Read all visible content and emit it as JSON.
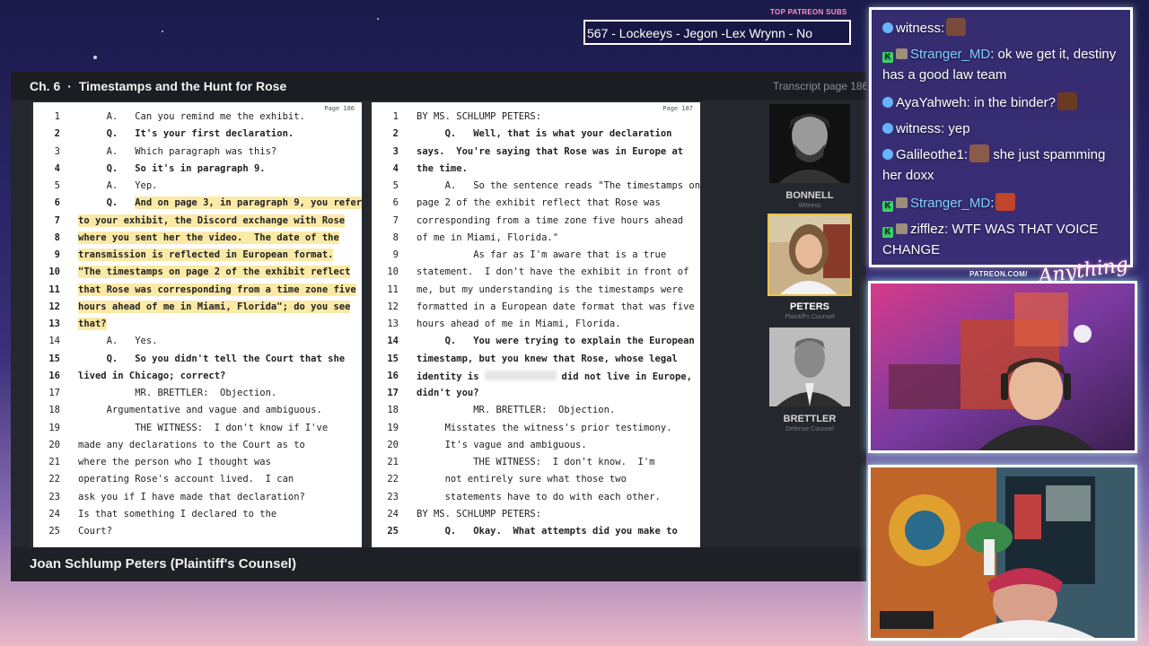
{
  "patreon": {
    "label": "TOP PATREON SUBS",
    "ticker": "567 - Lockeeys - Jegon -Lex Wrynn -  No"
  },
  "panel": {
    "chapter": "Ch. 6",
    "separator": "·",
    "chapter_title": "Timestamps and the Hunt for Rose",
    "transcript_page_label": "Transcript page 186",
    "speaker_caption": "Joan Schlump Peters (Plaintiff's Counsel)"
  },
  "left_page": {
    "page_label": "Page 186",
    "lines": [
      {
        "n": "1",
        "text": "     A.   Can you remind me the exhibit.",
        "bold": false,
        "hl": false
      },
      {
        "n": "2",
        "text": "     Q.   It's your first declaration.",
        "bold": true,
        "hl": false
      },
      {
        "n": "3",
        "text": "     A.   Which paragraph was this?",
        "bold": false,
        "hl": false
      },
      {
        "n": "4",
        "text": "     Q.   So it's in paragraph 9.",
        "bold": true,
        "hl": false
      },
      {
        "n": "5",
        "text": "     A.   Yep.",
        "bold": false,
        "hl": false
      },
      {
        "n": "6",
        "prefix": "     Q.   ",
        "text": "And on page 3, in paragraph 9, you refer",
        "bold": true,
        "hl": true
      },
      {
        "n": "7",
        "text": "to your exhibit, the Discord exchange with Rose",
        "bold": true,
        "hl": true
      },
      {
        "n": "8",
        "text": "where you sent her the video.  The date of the",
        "bold": true,
        "hl": true
      },
      {
        "n": "9",
        "text": "transmission is reflected in European format.",
        "bold": true,
        "hl": true
      },
      {
        "n": "10",
        "text": "\"The timestamps on page 2 of the exhibit reflect",
        "bold": true,
        "hl": true
      },
      {
        "n": "11",
        "text": "that Rose was corresponding from a time zone five",
        "bold": true,
        "hl": true
      },
      {
        "n": "12",
        "text": "hours ahead of me in Miami, Florida\"; do you see",
        "bold": true,
        "hl": true
      },
      {
        "n": "13",
        "text": "that?",
        "bold": true,
        "hl": true
      },
      {
        "n": "14",
        "text": "     A.   Yes.",
        "bold": false,
        "hl": false
      },
      {
        "n": "15",
        "text": "     Q.   So you didn't tell the Court that she",
        "bold": true,
        "hl": false
      },
      {
        "n": "16",
        "text": "lived in Chicago; correct?",
        "bold": true,
        "hl": false
      },
      {
        "n": "17",
        "text": "          MR. BRETTLER:  Objection.",
        "bold": false,
        "hl": false
      },
      {
        "n": "18",
        "text": "     Argumentative and vague and ambiguous.",
        "bold": false,
        "hl": false
      },
      {
        "n": "19",
        "text": "          THE WITNESS:  I don't know if I've",
        "bold": false,
        "hl": false
      },
      {
        "n": "20",
        "text": "made any declarations to the Court as to",
        "bold": false,
        "hl": false
      },
      {
        "n": "21",
        "text": "where the person who I thought was",
        "bold": false,
        "hl": false
      },
      {
        "n": "22",
        "text": "operating Rose's account lived.  I can",
        "bold": false,
        "hl": false
      },
      {
        "n": "23",
        "text": "ask you if I have made that declaration?",
        "bold": false,
        "hl": false
      },
      {
        "n": "24",
        "text": "Is that something I declared to the",
        "bold": false,
        "hl": false
      },
      {
        "n": "25",
        "text": "Court?",
        "bold": false,
        "hl": false
      }
    ]
  },
  "right_page": {
    "page_label": "Page 187",
    "lines": [
      {
        "n": "1",
        "text": "BY MS. SCHLUMP PETERS:",
        "bold": false
      },
      {
        "n": "2",
        "text": "     Q.   Well, that is what your declaration",
        "bold": true
      },
      {
        "n": "3",
        "text": "says.  You're saying that Rose was in Europe at",
        "bold": true
      },
      {
        "n": "4",
        "text": "the time.",
        "bold": true
      },
      {
        "n": "5",
        "text": "     A.   So the sentence reads \"The timestamps on",
        "bold": false
      },
      {
        "n": "6",
        "text": "page 2 of the exhibit reflect that Rose was",
        "bold": false
      },
      {
        "n": "7",
        "text": "corresponding from a time zone five hours ahead",
        "bold": false
      },
      {
        "n": "8",
        "text": "of me in Miami, Florida.\"",
        "bold": false
      },
      {
        "n": "9",
        "text": "          As far as I'm aware that is a true",
        "bold": false
      },
      {
        "n": "10",
        "text": "statement.  I don't have the exhibit in front of",
        "bold": false
      },
      {
        "n": "11",
        "text": "me, but my understanding is the timestamps were",
        "bold": false
      },
      {
        "n": "12",
        "text": "formatted in a European date format that was five",
        "bold": false
      },
      {
        "n": "13",
        "text": "hours ahead of me in Miami, Florida.",
        "bold": false
      },
      {
        "n": "14",
        "text": "     Q.   You were trying to explain the European",
        "bold": true
      },
      {
        "n": "15",
        "text": "timestamp, but you knew that Rose, whose legal",
        "bold": true
      },
      {
        "n": "16",
        "text": "identity is",
        "after": "did not live in Europe,",
        "bold": true,
        "redacted": true
      },
      {
        "n": "17",
        "text": "didn't you?",
        "bold": true
      },
      {
        "n": "18",
        "text": "          MR. BRETTLER:  Objection.",
        "bold": false
      },
      {
        "n": "19",
        "text": "     Misstates the witness's prior testimony.",
        "bold": false
      },
      {
        "n": "20",
        "text": "     It's vague and ambiguous.",
        "bold": false
      },
      {
        "n": "21",
        "text": "          THE WITNESS:  I don't know.  I'm",
        "bold": false
      },
      {
        "n": "22",
        "text": "     not entirely sure what those two",
        "bold": false
      },
      {
        "n": "23",
        "text": "     statements have to do with each other.",
        "bold": false
      },
      {
        "n": "24",
        "text": "BY MS. SCHLUMP PETERS:",
        "bold": false
      },
      {
        "n": "25",
        "text": "     Q.   Okay.  What attempts did you make to",
        "bold": true
      }
    ]
  },
  "speakers": [
    {
      "name": "BONNELL",
      "role": "Witness",
      "active": false
    },
    {
      "name": "PETERS",
      "role": "Plaintiff's Counsel",
      "active": true
    },
    {
      "name": "BRETTLER",
      "role": "Defense Counsel",
      "active": false
    }
  ],
  "chat": [
    {
      "badges": [
        "dot"
      ],
      "user": "witness",
      "sep": ":",
      "msg": "",
      "emote": "#7a4a3a",
      "style": "witness"
    },
    {
      "badges": [
        "k",
        "sub"
      ],
      "user": "Stranger_MD",
      "sep": ":",
      "msg": " ok we get it, destiny has a good law team",
      "style": "stranger"
    },
    {
      "badges": [
        "dot"
      ],
      "user": "AyaYahweh",
      "sep": ":",
      "msg": " in the binder?",
      "emote": "#6b3a22",
      "style": "plain"
    },
    {
      "badges": [
        "dot"
      ],
      "user": "witness",
      "sep": ":",
      "msg": " yep",
      "style": "witness"
    },
    {
      "badges": [
        "dot"
      ],
      "user": "Galileothe1",
      "sep": ":",
      "msg": " she just spamming her doxx",
      "emote": "#8a5a4a",
      "emote_inline": true,
      "style": "plain"
    },
    {
      "badges": [
        "k",
        "sub"
      ],
      "user": "Stranger_MD",
      "sep": ":",
      "msg": "",
      "emote": "#c0452a",
      "style": "stranger"
    },
    {
      "badges": [
        "k",
        "sub"
      ],
      "user": "zifflez",
      "sep": ":",
      "msg": " WTF WAS THAT VOICE CHANGE",
      "style": "plain"
    }
  ],
  "cam": {
    "patreon_url": "PATREON.COM/",
    "signature": "Anything Else?"
  },
  "colors": {
    "highlight": "#fbe9a6",
    "active_border": "#e8c44e",
    "panel_bg": "#24272d"
  }
}
